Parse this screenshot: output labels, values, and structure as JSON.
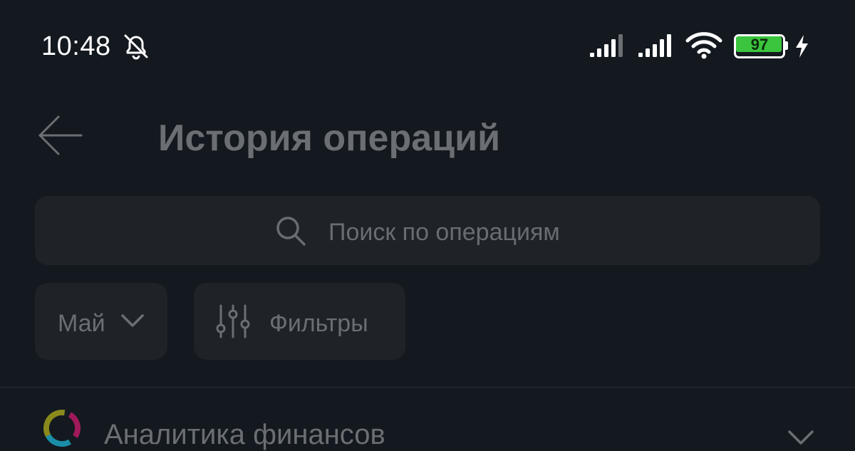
{
  "status_bar": {
    "time": "10:48",
    "notifications_icon": "bell-off-icon",
    "signal_1_icon": "signal-bars-icon",
    "signal_2_icon": "signal-bars-icon",
    "wifi_icon": "wifi-icon",
    "battery_level": 97,
    "battery_label": "97",
    "charging_icon": "lightning-bolt-icon",
    "battery_color": "#3bc43e"
  },
  "header": {
    "back_icon": "arrow-left-icon",
    "title": "История операций"
  },
  "search": {
    "icon": "search-icon",
    "placeholder": "Поиск по операциям"
  },
  "filters": {
    "month_label": "Май",
    "month_icon": "chevron-down-icon",
    "filters_label": "Фильтры",
    "filters_icon": "sliders-icon"
  },
  "analytics": {
    "icon": "donut-chart-icon",
    "label": "Аналитика финансов",
    "expand_icon": "chevron-down-icon",
    "ring_colors": [
      "#8a8a1c",
      "#a01a5a",
      "#1a8ea8"
    ]
  },
  "colors": {
    "background": "#141920",
    "surface": "#1f2327",
    "muted_text": "#6b6f73"
  }
}
